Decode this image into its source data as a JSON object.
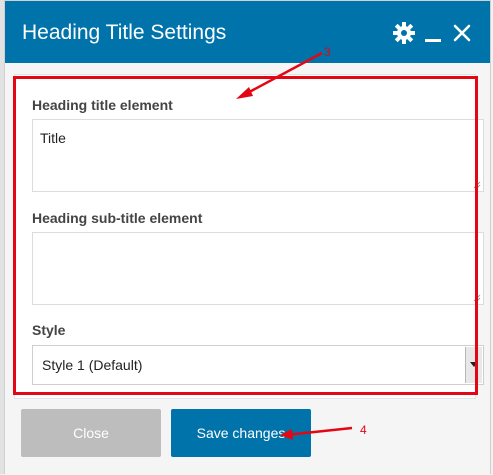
{
  "dialog": {
    "title": "Heading Title Settings",
    "icons": {
      "settings": "gear-icon",
      "minimize": "minus-icon",
      "close": "close-icon"
    },
    "accent_color": "#0073aa",
    "highlight_color": "#e30613"
  },
  "form": {
    "heading_title": {
      "label": "Heading title element",
      "value": "Title"
    },
    "heading_subtitle": {
      "label": "Heading sub-title element",
      "value": ""
    },
    "style": {
      "label": "Style",
      "selected": "Style 1 (Default)"
    }
  },
  "buttons": {
    "close_label": "Close",
    "save_label": "Save changes"
  },
  "annotations": {
    "marker_3": "3",
    "marker_4": "4"
  }
}
